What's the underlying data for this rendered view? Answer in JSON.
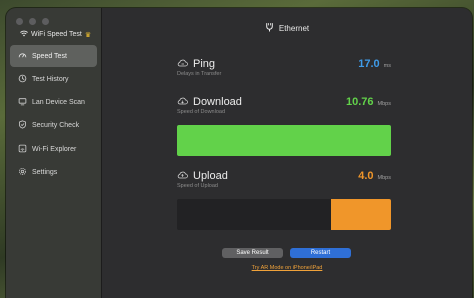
{
  "app": {
    "title": "WiFi Speed Test",
    "crown_icon": "crown-icon"
  },
  "sidebar": {
    "items": [
      {
        "label": "Speed Test",
        "icon": "speedometer-icon",
        "active": true
      },
      {
        "label": "Test History",
        "icon": "clock-icon",
        "active": false
      },
      {
        "label": "Lan Device Scan",
        "icon": "monitor-icon",
        "active": false
      },
      {
        "label": "Security Check",
        "icon": "shield-icon",
        "active": false
      },
      {
        "label": "Wi-Fi Explorer",
        "icon": "wifi-explorer-icon",
        "active": false
      },
      {
        "label": "Settings",
        "icon": "gear-icon",
        "active": false
      }
    ]
  },
  "header": {
    "connection": "Ethernet"
  },
  "metrics": {
    "ping": {
      "label": "Ping",
      "sub": "Delays in Transfer",
      "value": "17.0",
      "unit": "ms",
      "color": "#3f9be8"
    },
    "download": {
      "label": "Download",
      "sub": "Speed of Download",
      "value": "10.76",
      "unit": "Mbps",
      "color": "#62d24a",
      "fill_fraction": 1.0
    },
    "upload": {
      "label": "Upload",
      "sub": "Speed of Upload",
      "value": "4.0",
      "unit": "Mbps",
      "color": "#f0962a",
      "fill_fraction": 0.28
    }
  },
  "buttons": {
    "save": "Save Result",
    "restart": "Restart"
  },
  "link": "Try AR Mode on iPhone/iPad",
  "colors": {
    "accent_blue": "#2f6fd6",
    "download_green": "#62d24a",
    "upload_orange": "#f0962a",
    "ping_blue": "#3f9be8"
  }
}
